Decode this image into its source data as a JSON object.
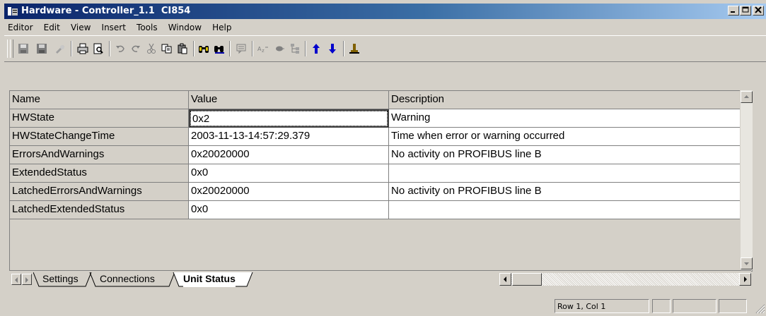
{
  "window": {
    "title": "Hardware - Controller_1.1  CI854",
    "min_icon": "minimize-icon",
    "max_icon": "maximize-icon",
    "close_icon": "close-icon"
  },
  "menu": [
    "Editor",
    "Edit",
    "View",
    "Insert",
    "Tools",
    "Window",
    "Help"
  ],
  "toolbar_icons": [
    "save-icon",
    "save-all-icon",
    "approve-icon",
    "print-icon",
    "print-preview-icon",
    "undo-icon",
    "redo-icon",
    "cut-icon",
    "copy-icon",
    "paste-icon",
    "find-icon",
    "find-replace-icon",
    "comment-icon",
    "rename-icon",
    "bullet-icon",
    "tree-icon",
    "move-up-icon",
    "move-down-icon",
    "stamp-icon"
  ],
  "table": {
    "headers": [
      "Name",
      "Value",
      "Description"
    ],
    "rows": [
      [
        "HWState",
        "0x2",
        "Warning"
      ],
      [
        "HWStateChangeTime",
        "2003-11-13-14:57:29.379",
        "Time when error or warning occurred"
      ],
      [
        "ErrorsAndWarnings",
        "0x20020000",
        "No activity on PROFIBUS line B"
      ],
      [
        "ExtendedStatus",
        "0x0",
        ""
      ],
      [
        "LatchedErrorsAndWarnings",
        "0x20020000",
        "No activity on PROFIBUS line B"
      ],
      [
        "LatchedExtendedStatus",
        "0x0",
        ""
      ]
    ]
  },
  "tabs": [
    {
      "label": "Settings",
      "active": false
    },
    {
      "label": "Connections",
      "active": false
    },
    {
      "label": "Unit Status",
      "active": true
    }
  ],
  "status": {
    "position": "Row 1, Col 1"
  },
  "colors": {
    "title_start": "#0a246a",
    "title_end": "#a6caf0",
    "face": "#d4d0c8",
    "up_arrow": "#0000cc",
    "down_arrow": "#0000cc",
    "stamp": "#806000"
  }
}
